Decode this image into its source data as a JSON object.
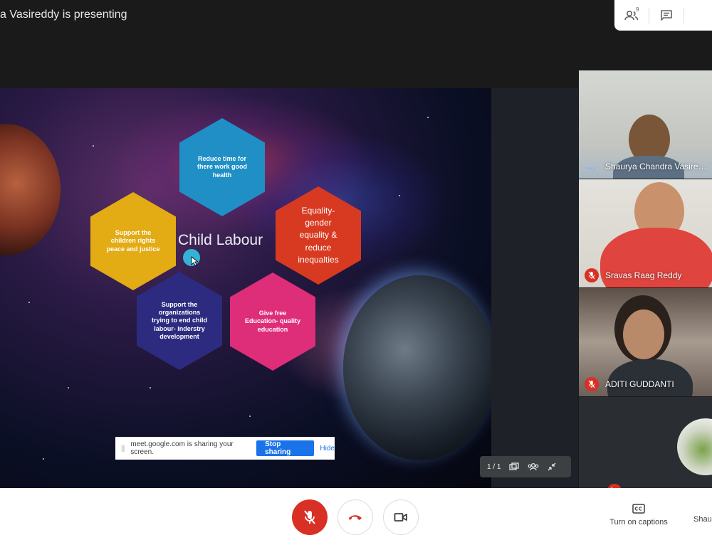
{
  "header": {
    "presenter_text": "a Vasireddy is presenting",
    "people_count": "9"
  },
  "slide": {
    "title": "Child Labour",
    "hexagons": {
      "blue": "Reduce time for there work good health",
      "yellow": "Support the children rights peace and justice",
      "red": "Equality- gender equality & reduce inequalties",
      "purple": "Support the organizations trying to end child labour- inderstry development",
      "pink": "Give free Education- quality education"
    }
  },
  "share_bar": {
    "message": "meet.google.com is sharing your screen.",
    "stop_label": "Stop sharing",
    "hide_label": "Hide"
  },
  "slide_controls": {
    "page_indicator": "1 / 1"
  },
  "participants": [
    {
      "name": "Shaurya Chandra Vasire…",
      "muted": false
    },
    {
      "name": "Sravas Raag Reddy",
      "muted": true
    },
    {
      "name": "ADITI GUDDANTI",
      "muted": true
    }
  ],
  "bottom_bar": {
    "captions_label": "Turn on captions",
    "presenting_label": "Shau"
  },
  "colors": {
    "accent": "#1a73e8",
    "danger": "#d93025",
    "hex_blue": "#1f8fc6",
    "hex_yellow": "#e3ab14",
    "hex_red": "#d73a20",
    "hex_purple": "#2c2b7f",
    "hex_pink": "#de2d79"
  }
}
